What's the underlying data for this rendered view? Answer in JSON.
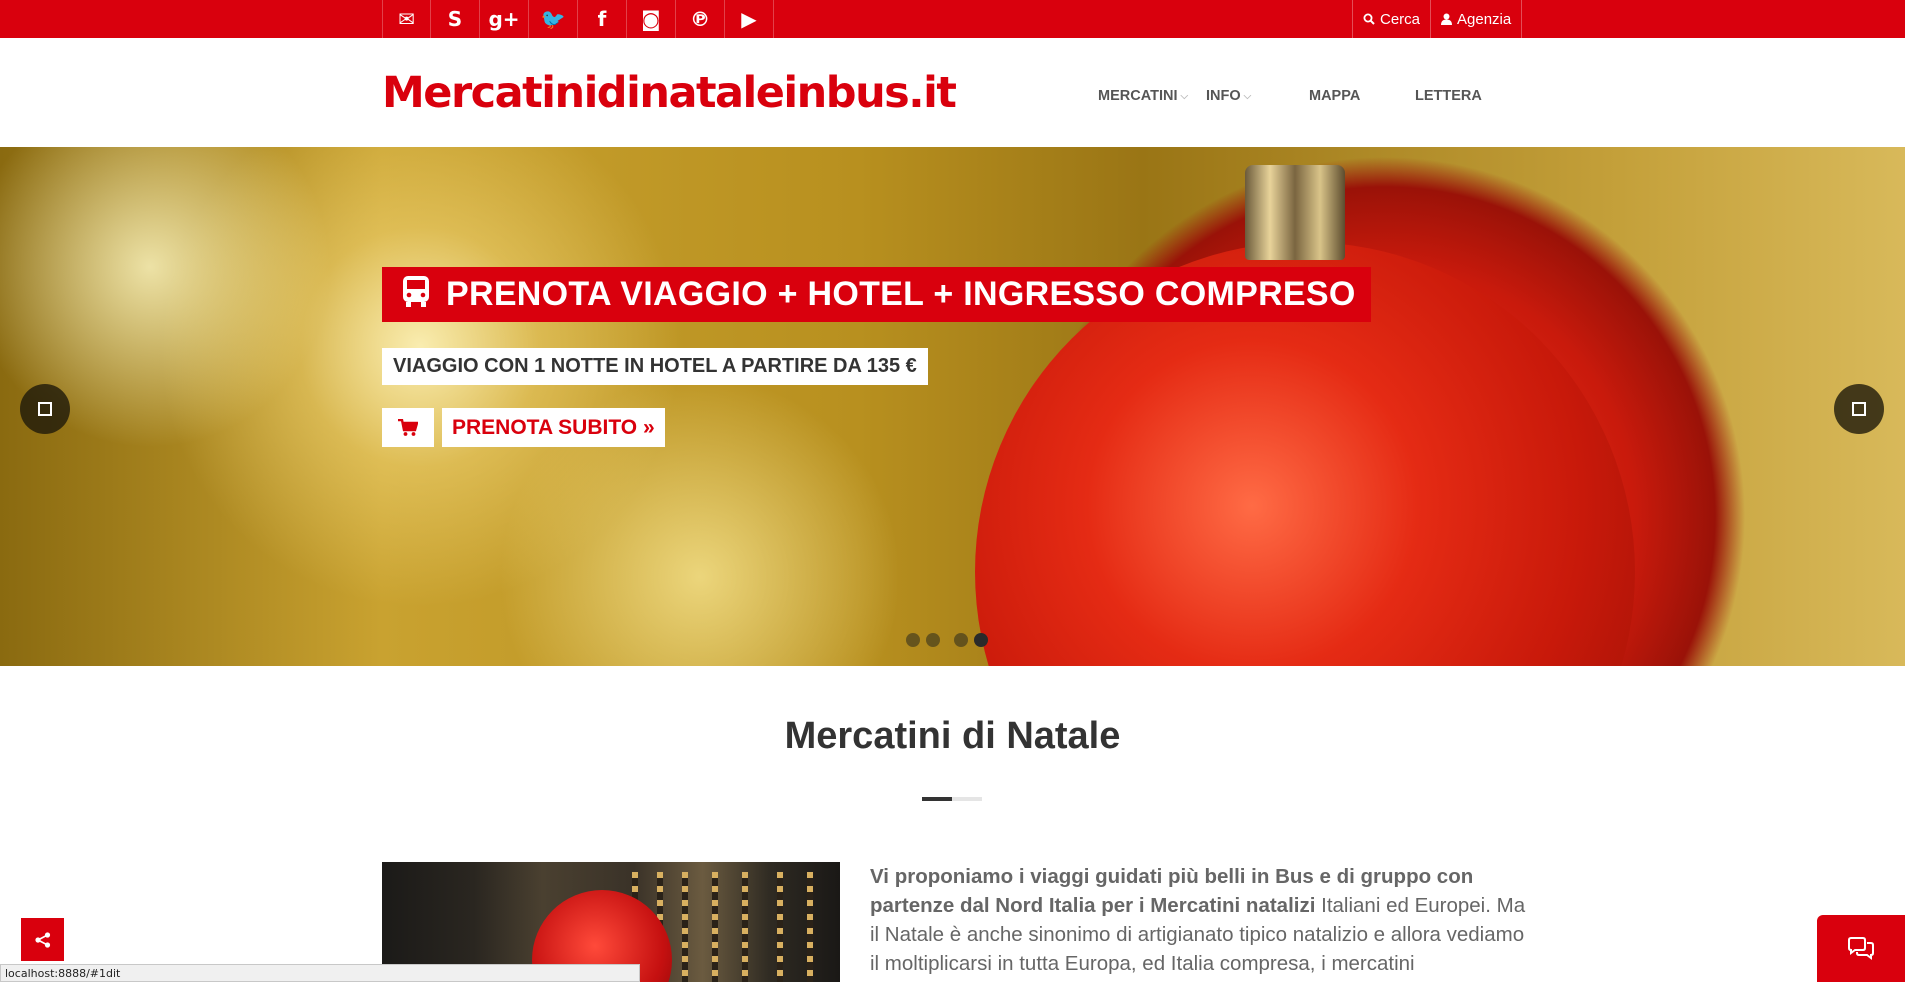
{
  "topbar": {
    "social": [
      {
        "icon": "envelope-icon",
        "glyph": "✉"
      },
      {
        "icon": "skype-icon",
        "glyph": "S"
      },
      {
        "icon": "google-plus-icon",
        "glyph": "g+"
      },
      {
        "icon": "twitter-icon",
        "glyph": "🐦"
      },
      {
        "icon": "facebook-icon",
        "glyph": "f"
      },
      {
        "icon": "instagram-icon",
        "glyph": "◙"
      },
      {
        "icon": "pinterest-icon",
        "glyph": "℗"
      },
      {
        "icon": "youtube-icon",
        "glyph": "▶"
      }
    ],
    "search_label": "Cerca",
    "agency_label": "Agenzia"
  },
  "header": {
    "logo": "Mercatinidinataleinbus.it",
    "nav": [
      {
        "label": "MERCATINI",
        "has_dropdown": true
      },
      {
        "label": "INFO",
        "has_dropdown": true
      },
      {
        "label": "MAPPA",
        "has_dropdown": false
      },
      {
        "label": "LETTERA",
        "has_dropdown": false
      }
    ]
  },
  "hero": {
    "headline": "PRENOTA VIAGGIO + HOTEL + INGRESSO COMPRESO",
    "subline": "VIAGGIO CON 1 NOTTE IN HOTEL A PARTIRE DA 135 €",
    "cta_label": "PRENOTA SUBITO »",
    "slides_count": 4,
    "active_slide": 4
  },
  "section": {
    "title": "Mercatini di Natale",
    "intro_bold": "Vi proponiamo i viaggi guidati più belli in Bus e di gruppo con partenze dal Nord Italia per i Mercatini natalizi",
    "intro_text": " Italiani ed Europei. Ma il Natale è anche sinonimo di artigianato tipico natalizio e allora vediamo il moltiplicarsi in tutta Europa, ed Italia compresa, i mercatini"
  },
  "statusbar": {
    "url": "localhost:8888/#1dit"
  },
  "colors": {
    "brand_red": "#d9000d",
    "text_dark": "#333333",
    "text_gray": "#666666"
  }
}
